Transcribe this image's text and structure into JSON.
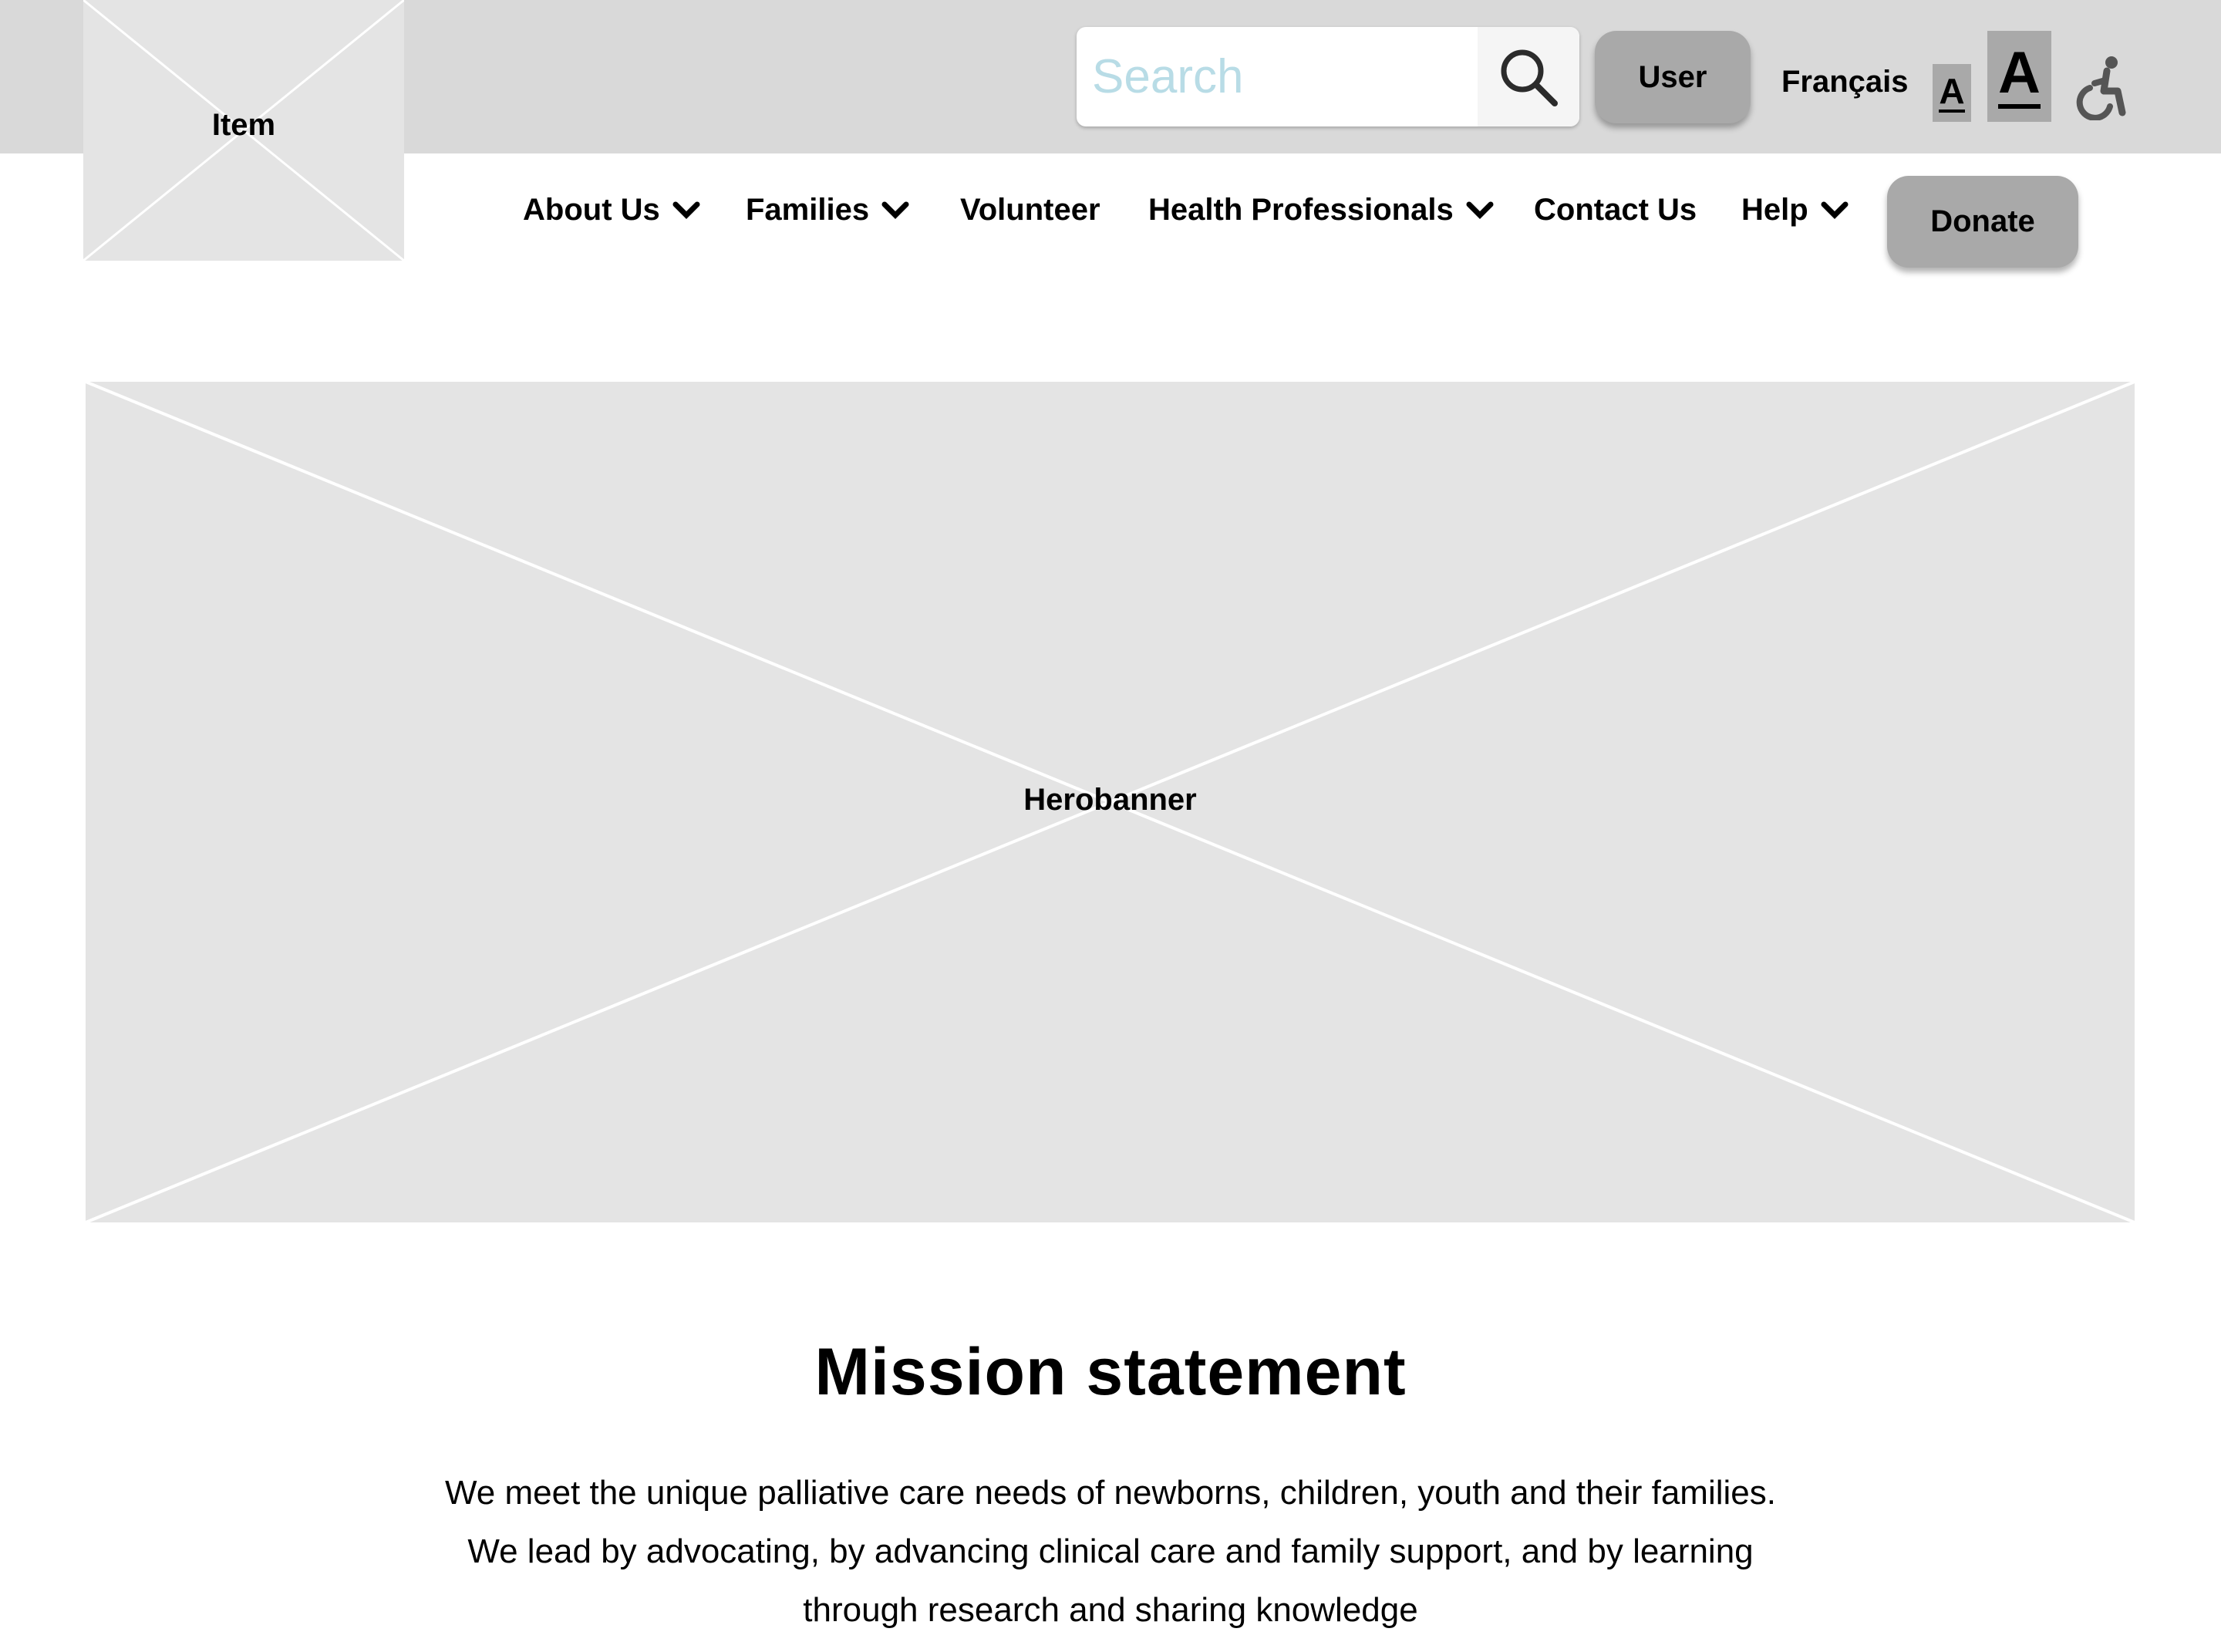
{
  "header": {
    "logo_label": "Item",
    "search": {
      "placeholder": "Search"
    },
    "user_label": "User",
    "language_label": "Français",
    "font_small_label": "A",
    "font_large_label": "A",
    "accessibility_icon": "wheelchair-icon",
    "search_icon": "search-icon"
  },
  "nav": {
    "items": [
      {
        "label": "About Us",
        "has_dropdown": true
      },
      {
        "label": "Families",
        "has_dropdown": true
      },
      {
        "label": "Volunteer",
        "has_dropdown": false
      },
      {
        "label": "Health Professionals",
        "has_dropdown": true
      },
      {
        "label": "Contact Us",
        "has_dropdown": false
      },
      {
        "label": "Help",
        "has_dropdown": true
      }
    ],
    "donate_label": "Donate"
  },
  "hero": {
    "label": "Herobanner"
  },
  "mission": {
    "title": "Mission statement",
    "lines": [
      "We meet the unique palliative care needs of newborns, children, youth and their families.",
      "We lead by advocating, by advancing clinical care and family support, and by learning",
      "through research and sharing knowledge"
    ]
  },
  "colors": {
    "top_bar": "#d9d9d9",
    "placeholder_fill": "#e4e4e4",
    "button_grey": "#a9a9a9",
    "search_placeholder": "#b8dce6"
  }
}
